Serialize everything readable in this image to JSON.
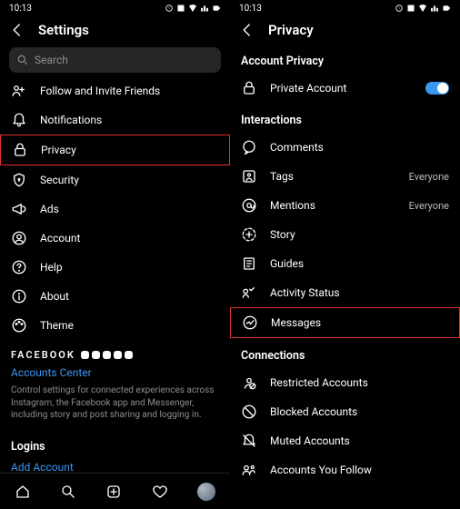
{
  "left": {
    "time": "10:13",
    "header": "Settings",
    "search_placeholder": "Search",
    "rows": [
      {
        "icon": "follow-invite-icon",
        "label": "Follow and Invite Friends"
      },
      {
        "icon": "bell-icon",
        "label": "Notifications"
      },
      {
        "icon": "lock-icon",
        "label": "Privacy",
        "highlight": true
      },
      {
        "icon": "shield-icon",
        "label": "Security"
      },
      {
        "icon": "megaphone-icon",
        "label": "Ads"
      },
      {
        "icon": "account-icon",
        "label": "Account"
      },
      {
        "icon": "help-icon",
        "label": "Help"
      },
      {
        "icon": "info-icon",
        "label": "About"
      },
      {
        "icon": "palette-icon",
        "label": "Theme"
      }
    ],
    "facebook_label": "FACEBOOK",
    "accounts_center": "Accounts Center",
    "accounts_desc": "Control settings for connected experiences across Instagram, the Facebook app and Messenger, including story and post sharing and logging in.",
    "logins_label": "Logins",
    "add_account": "Add Account"
  },
  "right": {
    "time": "10:13",
    "header": "Privacy",
    "sections": [
      {
        "title": "Account Privacy",
        "rows": [
          {
            "icon": "lock-icon",
            "label": "Private Account",
            "toggle": true
          }
        ]
      },
      {
        "title": "Interactions",
        "rows": [
          {
            "icon": "comments-icon",
            "label": "Comments"
          },
          {
            "icon": "tags-icon",
            "label": "Tags",
            "value": "Everyone"
          },
          {
            "icon": "mentions-icon",
            "label": "Mentions",
            "value": "Everyone"
          },
          {
            "icon": "story-icon",
            "label": "Story"
          },
          {
            "icon": "guides-icon",
            "label": "Guides"
          },
          {
            "icon": "activity-icon",
            "label": "Activity Status"
          },
          {
            "icon": "messages-icon",
            "label": "Messages",
            "highlight": true
          }
        ]
      },
      {
        "title": "Connections",
        "rows": [
          {
            "icon": "restricted-icon",
            "label": "Restricted Accounts"
          },
          {
            "icon": "blocked-icon",
            "label": "Blocked Accounts"
          },
          {
            "icon": "muted-icon",
            "label": "Muted Accounts"
          },
          {
            "icon": "follow-icon",
            "label": "Accounts You Follow"
          }
        ]
      }
    ]
  }
}
